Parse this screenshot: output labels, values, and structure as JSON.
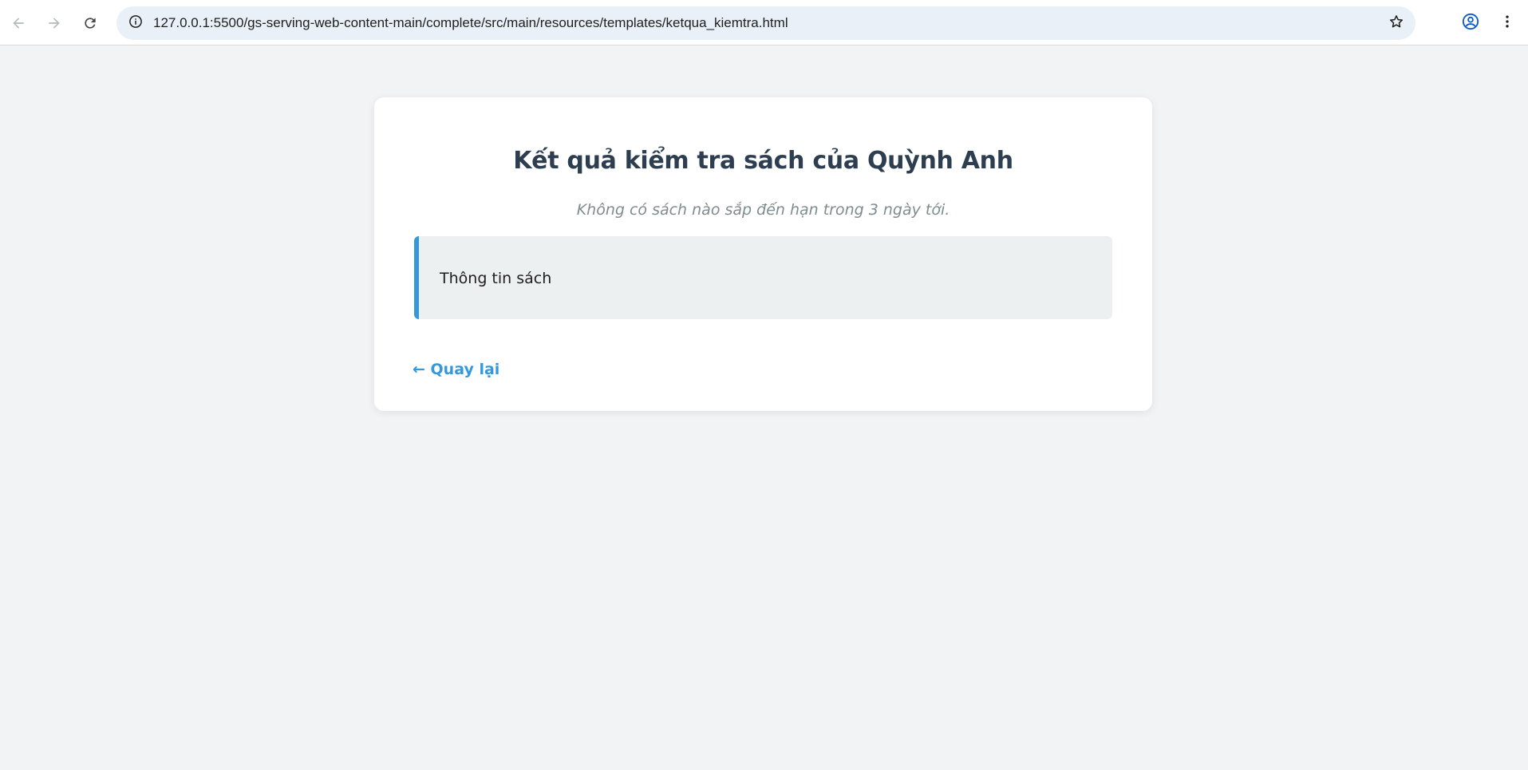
{
  "browser": {
    "url": "127.0.0.1:5500/gs-serving-web-content-main/complete/src/main/resources/templates/ketqua_kiemtra.html",
    "icons": {
      "back": "arrow-left-icon",
      "forward": "arrow-right-icon",
      "reload": "reload-icon",
      "site_info": "info-icon",
      "bookmark": "star-icon",
      "profile": "account-circle-icon",
      "menu": "more-vertical-icon"
    }
  },
  "page": {
    "title": "Kết quả kiểm tra sách của Quỳnh Anh",
    "empty_message": "Không có sách nào sắp đến hạn trong 3 ngày tới.",
    "info_box_label": "Thông tin sách",
    "back_link": "← Quay lại"
  },
  "colors": {
    "page_background": "#f2f3f5",
    "card_background": "#ffffff",
    "title": "#2c3e50",
    "muted_text": "#7f8c8d",
    "info_box_background": "#ecf0f1",
    "accent": "#3498db",
    "omnibox_background": "#eaf0f8",
    "profile_icon": "#0b57d0"
  }
}
